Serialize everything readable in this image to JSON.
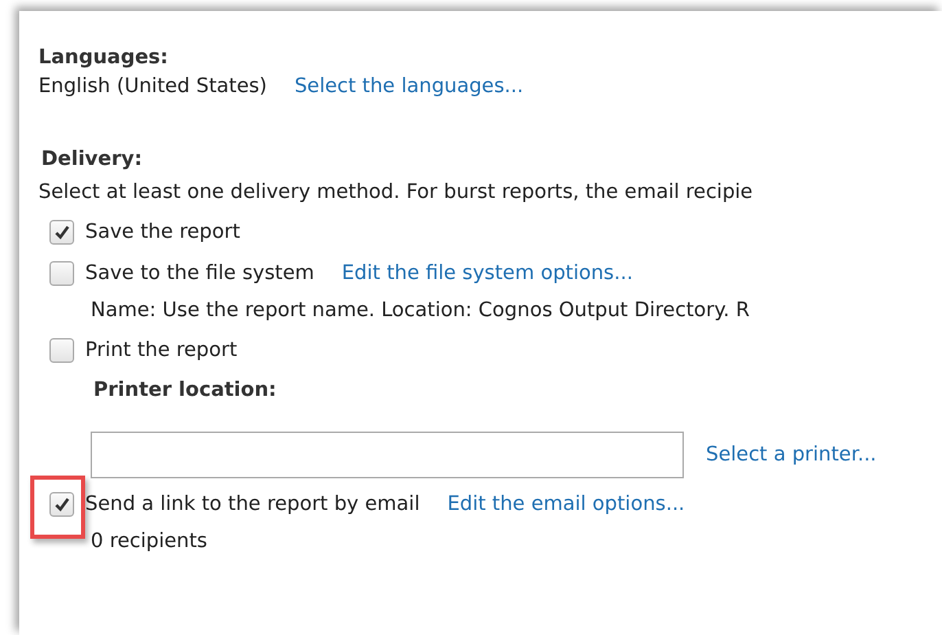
{
  "languages": {
    "label": "Languages:",
    "value": "English (United States)",
    "link": "Select the languages..."
  },
  "delivery": {
    "label": "Delivery:",
    "instructions": "Select at least one delivery method. For burst reports, the email recipie",
    "options": [
      {
        "label": "Save the report",
        "checked": true,
        "highlighted": false
      },
      {
        "label": "Save to the file system",
        "checked": false,
        "highlighted": false,
        "link": "Edit the file system options...",
        "note": "Name: Use the report name. Location: Cognos Output Directory. R"
      },
      {
        "label": "Print the report",
        "checked": false,
        "highlighted": false,
        "printer": {
          "label": "Printer location:",
          "link": "Select a printer..."
        }
      },
      {
        "label": "Send a link to the report by email",
        "checked": true,
        "highlighted": true,
        "link": "Edit the email options...",
        "note": "0 recipients"
      }
    ]
  }
}
